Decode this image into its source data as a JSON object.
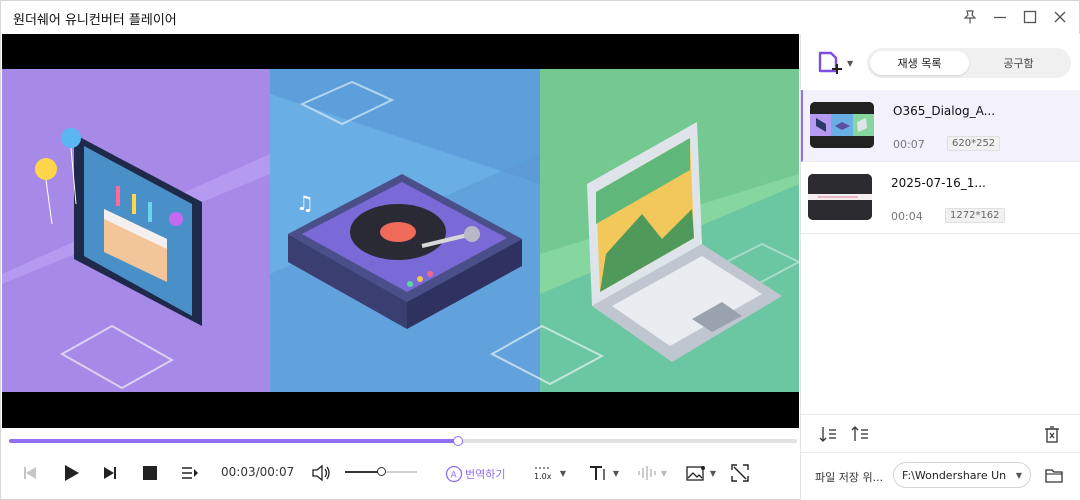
{
  "window": {
    "title": "원더쉐어 유니컨버터 플레이어",
    "pin_icon": "pin-icon",
    "minimize_icon": "minimize-icon",
    "maximize_icon": "maximize-icon",
    "close_icon": "close-icon"
  },
  "player": {
    "current_time": "00:03",
    "total_time": "00:07",
    "time_display": "00:03/00:07",
    "progress_fraction": 0.57,
    "volume_fraction": 0.5,
    "translate_label": "번역하기",
    "speed_label": "1.0x",
    "accent_color": "#8f6ff5"
  },
  "playlist": {
    "tabs": [
      {
        "label": "재생 목록",
        "active": true
      },
      {
        "label": "공구함",
        "active": false
      }
    ],
    "items": [
      {
        "name": "O365_Dialog_A...",
        "duration": "00:07",
        "resolution": "620*252",
        "active": true
      },
      {
        "name": "2025-07-16_1...",
        "duration": "00:04",
        "resolution": "1272*162",
        "active": false
      }
    ],
    "save_label": "파일 저장 위...",
    "save_path": "F:\\Wondershare Un"
  }
}
